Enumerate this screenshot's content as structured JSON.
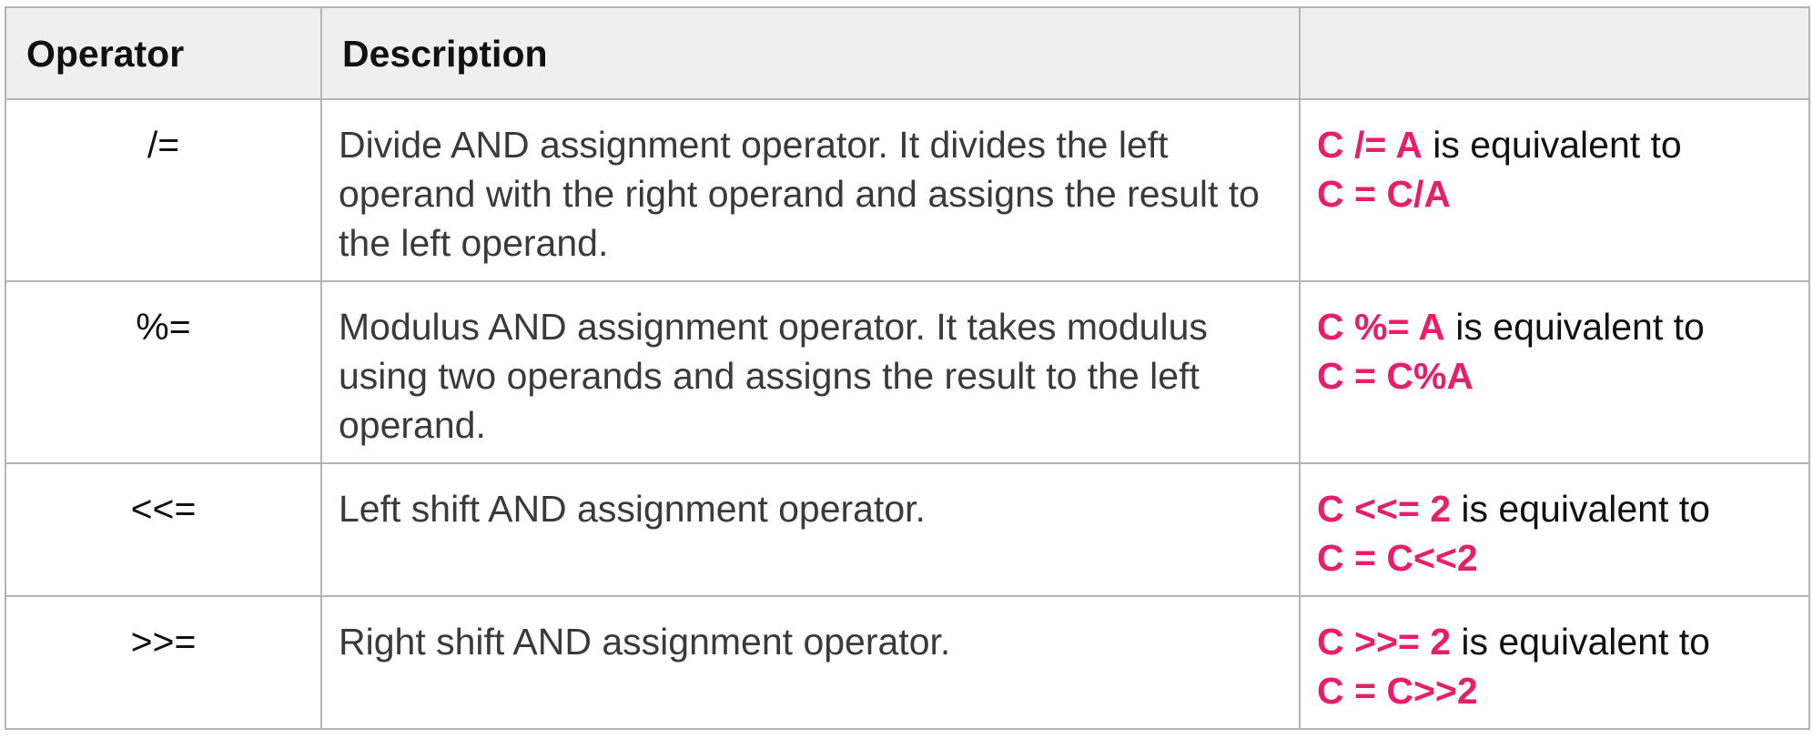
{
  "table": {
    "headers": [
      "Operator",
      "Description",
      ""
    ],
    "rows": [
      {
        "operator": "/=",
        "description": "Divide AND assignment operator. It divides the left operand with the right operand and assigns the result to the left operand.",
        "example_code": "C /= A",
        "example_text": " is equivalent to",
        "example_result": "C = C/A"
      },
      {
        "operator": "%=",
        "description": "Modulus AND assignment operator. It takes modulus using two operands and assigns the result to the left operand.",
        "example_code": "C %= A",
        "example_text": " is equivalent to",
        "example_result": "C = C%A"
      },
      {
        "operator": "<<=",
        "description": "Left shift AND assignment operator.",
        "example_code": "C <<= 2",
        "example_text": " is equivalent to",
        "example_result": "C = C<<2"
      },
      {
        "operator": ">>=",
        "description": "Right shift AND assignment operator.",
        "example_code": "C >>= 2",
        "example_text": " is equivalent to",
        "example_result": "C = C>>2"
      }
    ]
  },
  "colors": {
    "highlight": "#e61f68",
    "header_bg": "#efefef",
    "border": "#b4b4b4"
  }
}
